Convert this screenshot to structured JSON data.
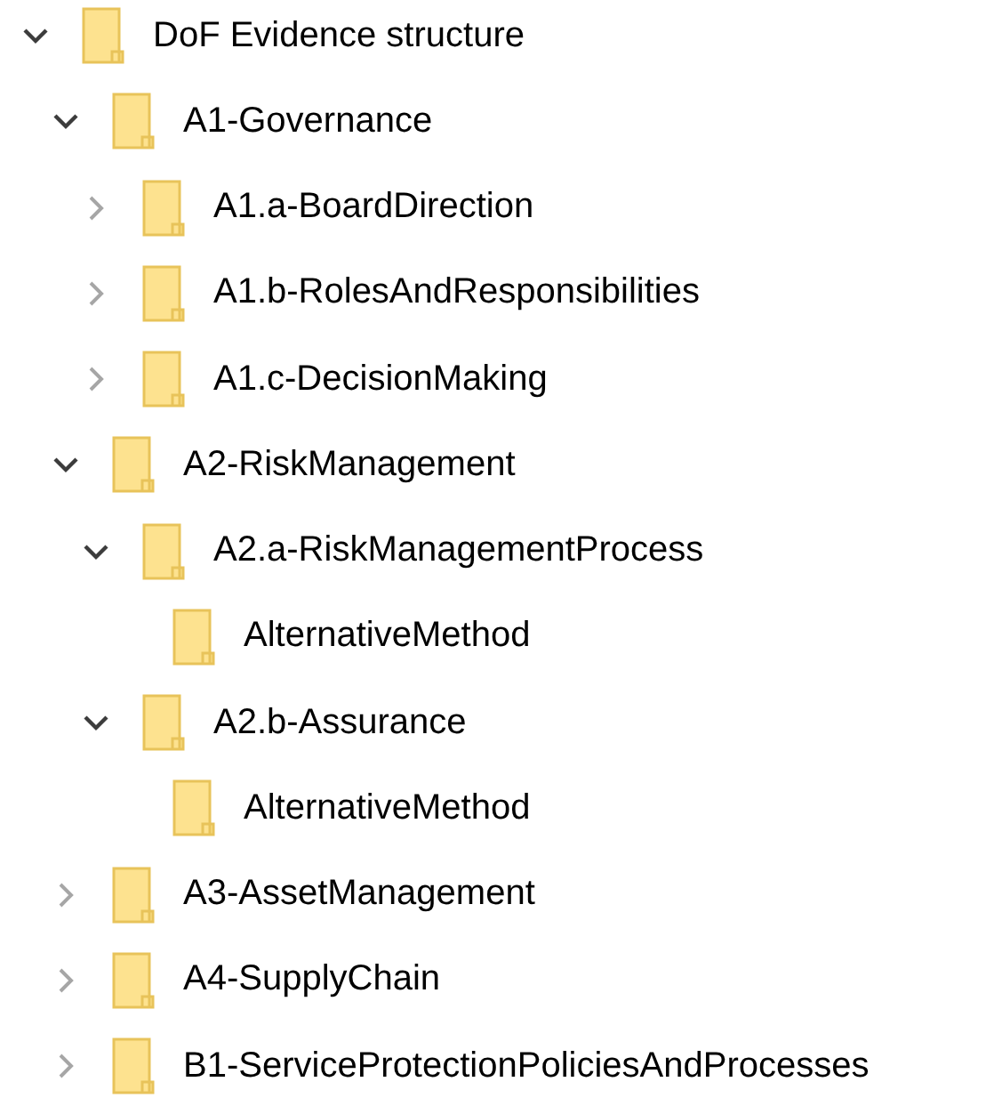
{
  "tree": [
    {
      "label": "DoF Evidence structure",
      "expandable": true,
      "expanded": true,
      "children": [
        {
          "label": "A1-Governance",
          "expandable": true,
          "expanded": true,
          "children": [
            {
              "label": "A1.a-BoardDirection",
              "expandable": true,
              "expanded": false
            },
            {
              "label": "A1.b-RolesAndResponsibilities",
              "expandable": true,
              "expanded": false
            },
            {
              "label": "A1.c-DecisionMaking",
              "expandable": true,
              "expanded": false
            }
          ]
        },
        {
          "label": "A2-RiskManagement",
          "expandable": true,
          "expanded": true,
          "children": [
            {
              "label": "A2.a-RiskManagementProcess",
              "expandable": true,
              "expanded": true,
              "children": [
                {
                  "label": "AlternativeMethod",
                  "expandable": false
                }
              ]
            },
            {
              "label": "A2.b-Assurance",
              "expandable": true,
              "expanded": true,
              "children": [
                {
                  "label": "AlternativeMethod",
                  "expandable": false
                }
              ]
            }
          ]
        },
        {
          "label": "A3-AssetManagement",
          "expandable": true,
          "expanded": false
        },
        {
          "label": "A4-SupplyChain",
          "expandable": true,
          "expanded": false
        },
        {
          "label": "B1-ServiceProtectionPoliciesAndProcesses",
          "expandable": true,
          "expanded": false
        }
      ]
    }
  ]
}
